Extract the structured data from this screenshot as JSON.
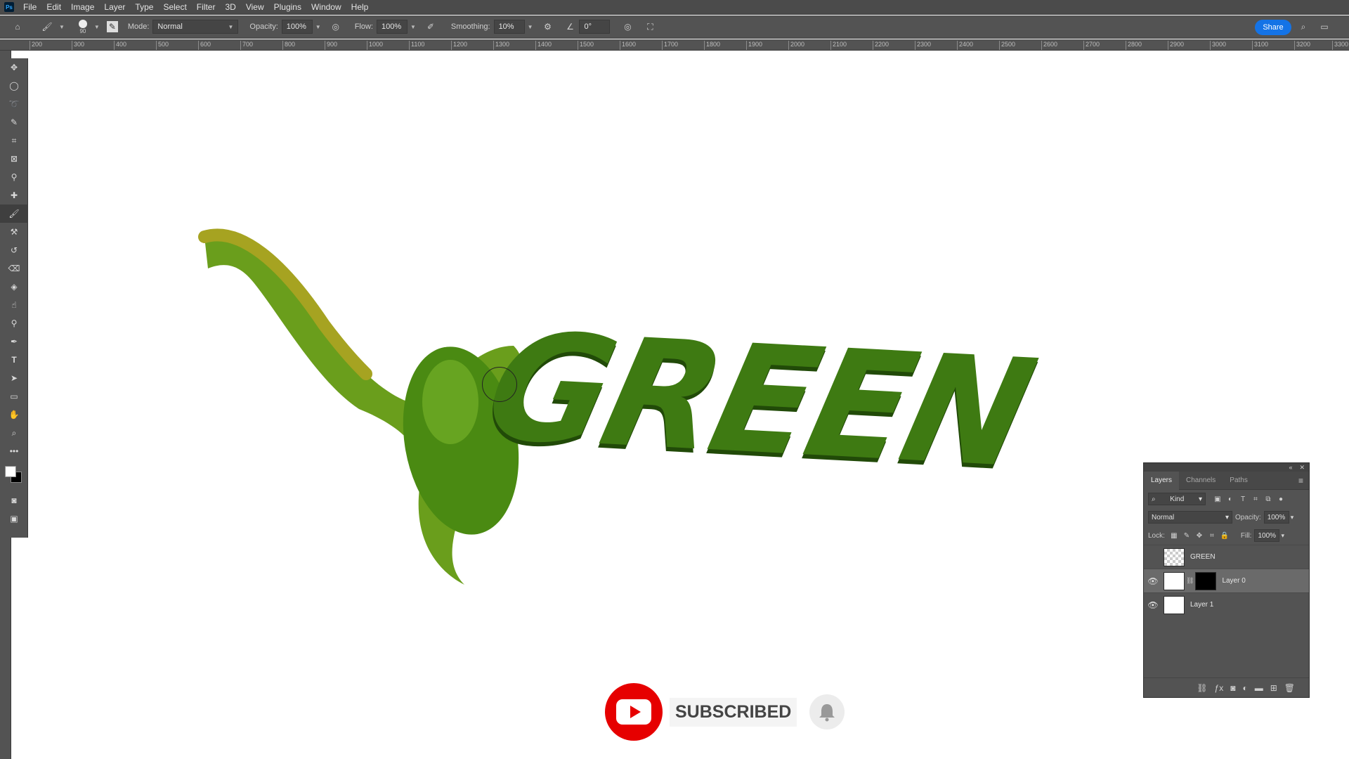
{
  "menu": [
    "File",
    "Edit",
    "Image",
    "Layer",
    "Type",
    "Select",
    "Filter",
    "3D",
    "View",
    "Plugins",
    "Window",
    "Help"
  ],
  "app_logo": "Ps",
  "options": {
    "brush_size": "90",
    "mode_label": "Mode:",
    "mode_value": "Normal",
    "opacity_label": "Opacity:",
    "opacity_value": "100%",
    "flow_label": "Flow:",
    "flow_value": "100%",
    "smoothing_label": "Smoothing:",
    "smoothing_value": "10%",
    "angle_value": "0°",
    "share_label": "Share"
  },
  "ruler_ticks": [
    "200",
    "300",
    "400",
    "500",
    "600",
    "700",
    "800",
    "900",
    "1000",
    "1100",
    "1200",
    "1300",
    "1400",
    "1500",
    "1600",
    "1700",
    "1800",
    "1900",
    "2000",
    "2100",
    "2200",
    "2300",
    "2400",
    "2500",
    "2600",
    "2700",
    "2800",
    "2900",
    "3000",
    "3100",
    "3200",
    "3300"
  ],
  "canvas": {
    "artwork_text": "GREEN",
    "subscribe_text": "SUBSCRIBED"
  },
  "layers_panel": {
    "tabs": [
      "Layers",
      "Channels",
      "Paths"
    ],
    "filter_kind": "Kind",
    "blend_mode": "Normal",
    "opacity_label": "Opacity:",
    "opacity_value": "100%",
    "lock_label": "Lock:",
    "fill_label": "Fill:",
    "fill_value": "100%",
    "layers": [
      {
        "name": "GREEN",
        "visible": false
      },
      {
        "name": "Layer 0",
        "visible": true
      },
      {
        "name": "Layer 1",
        "visible": true
      }
    ]
  },
  "colors": {
    "accent": "#1473e6",
    "foreground": "#ffffff",
    "background": "#000000",
    "youtube_red": "#e60000"
  }
}
